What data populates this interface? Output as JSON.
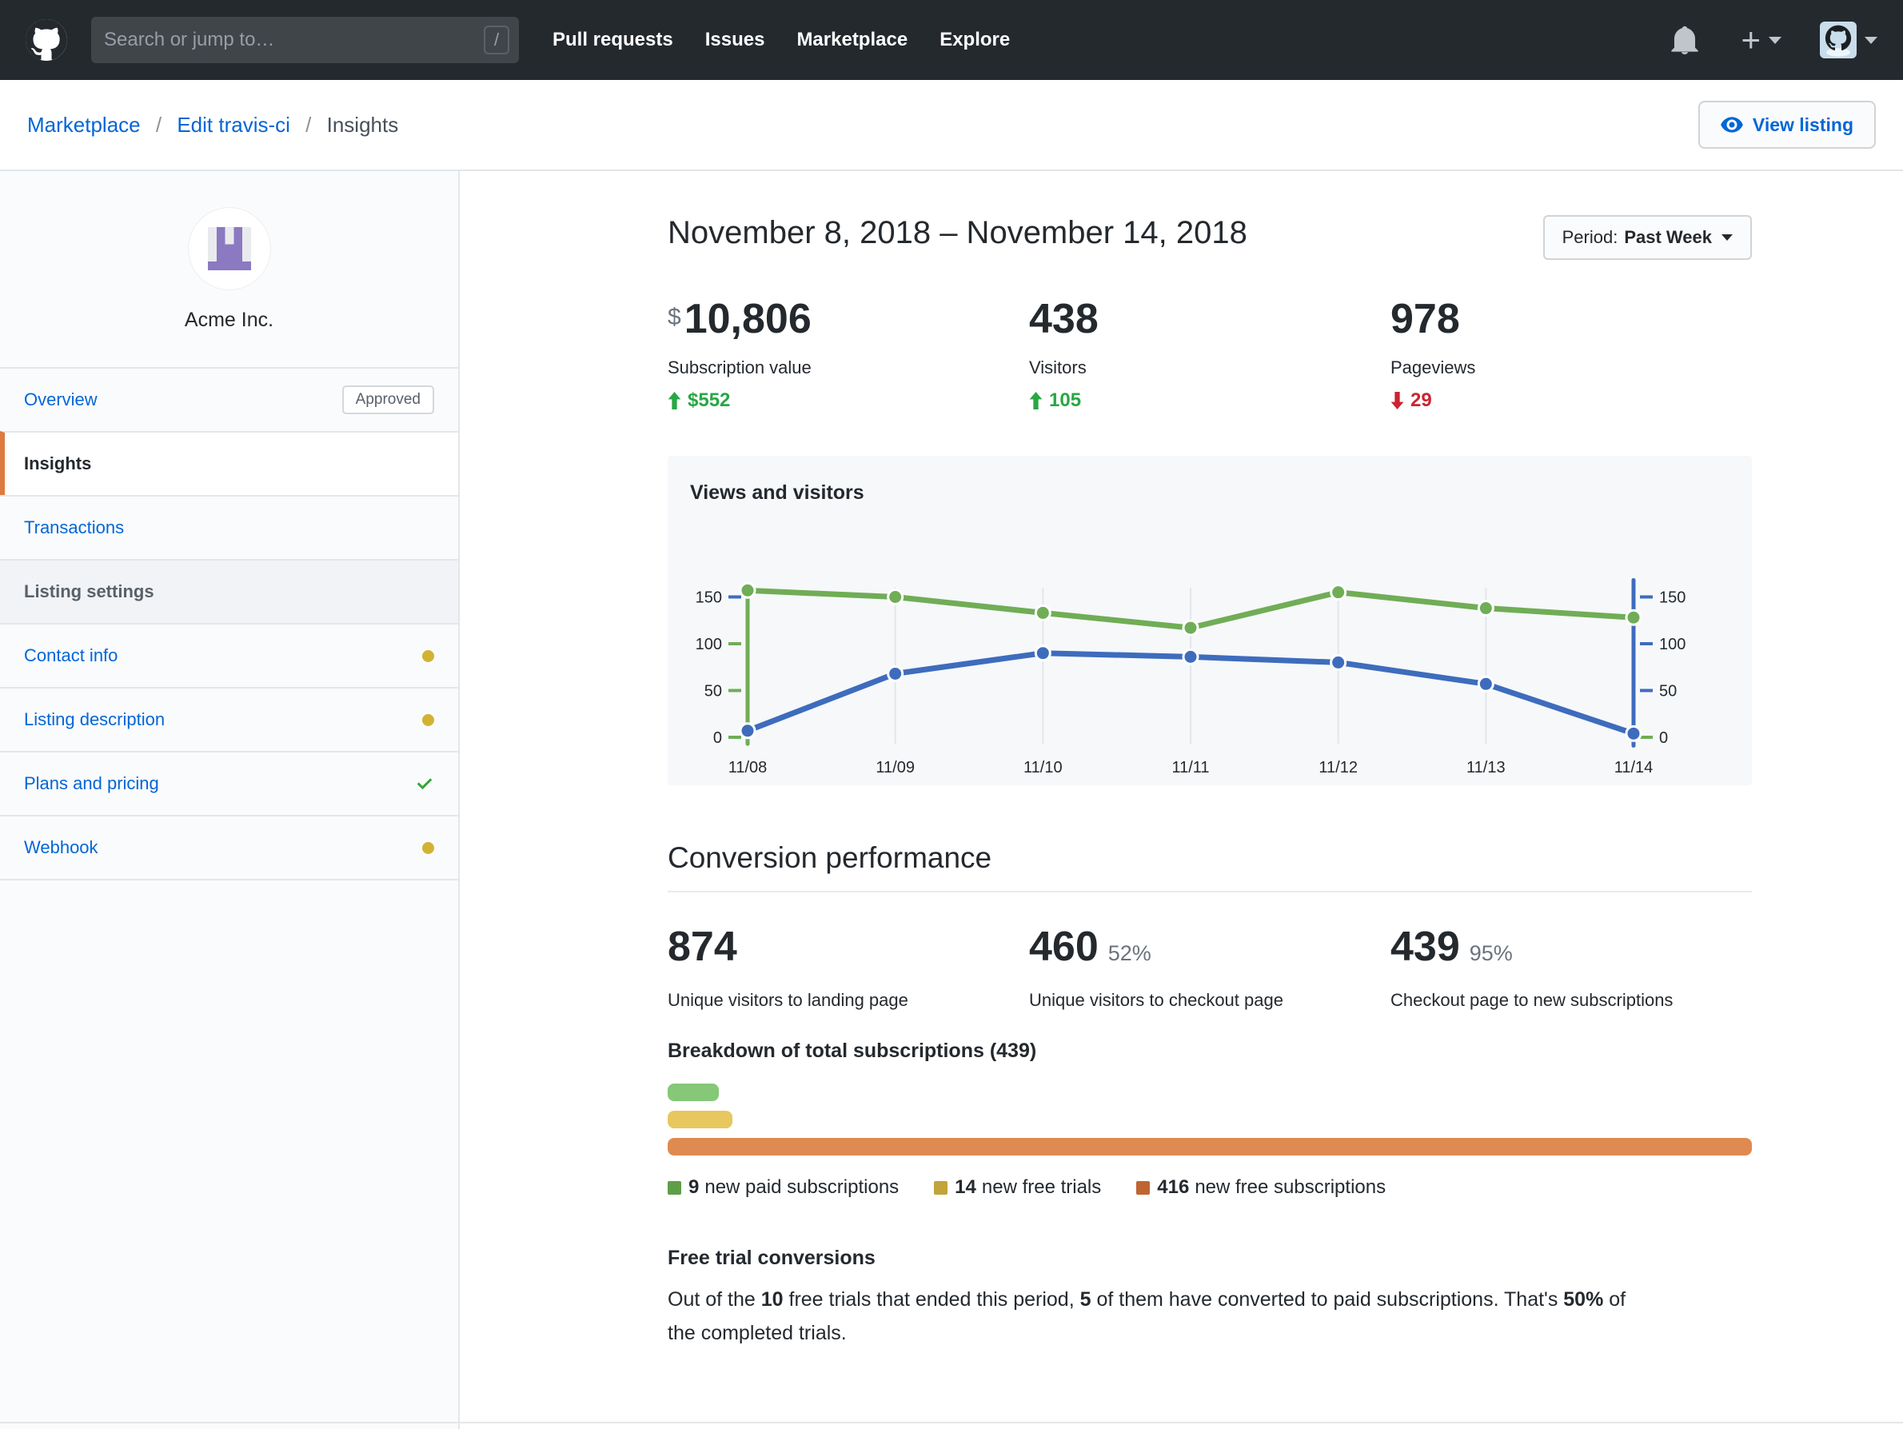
{
  "header": {
    "search_placeholder": "Search or jump to…",
    "slash_key": "/",
    "nav": [
      "Pull requests",
      "Issues",
      "Marketplace",
      "Explore"
    ]
  },
  "breadcrumb": {
    "items": [
      "Marketplace",
      "Edit travis-ci",
      "Insights"
    ],
    "separator": "/"
  },
  "actions": {
    "view_listing": "View listing"
  },
  "sidebar": {
    "org_name": "Acme Inc.",
    "items": [
      {
        "label": "Overview",
        "badge": "Approved"
      },
      {
        "label": "Insights",
        "active": true
      },
      {
        "label": "Transactions"
      },
      {
        "label": "Listing settings",
        "header": true
      },
      {
        "label": "Contact info",
        "status": "pending"
      },
      {
        "label": "Listing description",
        "status": "pending"
      },
      {
        "label": "Plans and pricing",
        "status": "done"
      },
      {
        "label": "Webhook",
        "status": "pending"
      }
    ]
  },
  "main": {
    "date_range": "November 8, 2018 – November 14, 2018",
    "period": {
      "label": "Period:",
      "value": "Past Week"
    },
    "stats": [
      {
        "prefix": "$",
        "value": "10,806",
        "label": "Subscription value",
        "delta": "$552",
        "direction": "up"
      },
      {
        "value": "438",
        "label": "Visitors",
        "delta": "105",
        "direction": "up"
      },
      {
        "value": "978",
        "label": "Pageviews",
        "delta": "29",
        "direction": "down"
      }
    ],
    "conversion": {
      "heading": "Conversion performance",
      "stats": [
        {
          "value": "874",
          "pct": "",
          "label": "Unique visitors to landing page"
        },
        {
          "value": "460",
          "pct": "52%",
          "label": "Unique visitors to checkout page"
        },
        {
          "value": "439",
          "pct": "95%",
          "label": "Checkout page to new subscriptions"
        }
      ]
    },
    "breakdown": {
      "heading": "Breakdown of total subscriptions (439)",
      "bars": [
        {
          "count": 9,
          "label": "new paid subscriptions",
          "color": "#84c878",
          "legend_color": "#5f9e48",
          "width_pct": 4.7
        },
        {
          "count": 14,
          "label": "new free trials",
          "color": "#e8c85e",
          "legend_color": "#c3a33b",
          "width_pct": 6.0
        },
        {
          "count": 416,
          "label": "new free subscriptions",
          "color": "#df8a50",
          "legend_color": "#bf6531",
          "width_pct": 100
        }
      ]
    },
    "free_trial": {
      "heading": "Free trial conversions",
      "segments": [
        {
          "t": "Out of the "
        },
        {
          "t": "10",
          "b": true
        },
        {
          "t": " free trials that ended this period, "
        },
        {
          "t": "5",
          "b": true
        },
        {
          "t": " of them have converted to paid subscriptions. That's "
        },
        {
          "t": "50%",
          "b": true
        },
        {
          "t": " of the completed trials."
        }
      ]
    }
  },
  "chart_data": {
    "type": "line",
    "title": "Views and visitors",
    "x": [
      "11/08",
      "11/09",
      "11/10",
      "11/11",
      "11/12",
      "11/13",
      "11/14"
    ],
    "series": [
      {
        "name": "Views (pageviews)",
        "color": "#70ad56",
        "axis": "left",
        "values": [
          157,
          150,
          133,
          117,
          155,
          138,
          128
        ]
      },
      {
        "name": "Visitors",
        "color": "#3e6cbd",
        "axis": "right",
        "values": [
          7,
          68,
          90,
          86,
          80,
          57,
          4
        ]
      }
    ],
    "y_ticks": [
      0,
      50,
      100,
      150
    ],
    "ylim": [
      0,
      160
    ],
    "grid": "vertical",
    "legend": "none"
  },
  "colors": {
    "header_bg": "#24292e",
    "link_blue": "#0366d6",
    "border": "#e4e6e9",
    "panel_bg": "#f6f8fa",
    "delta_green": "#28a745",
    "delta_red": "#cb2431",
    "pending_dot": "#d3b233",
    "done_check": "#34a53a",
    "active_marker": "#dd7a3f",
    "org_avatar_purple": "#8b79c1"
  }
}
